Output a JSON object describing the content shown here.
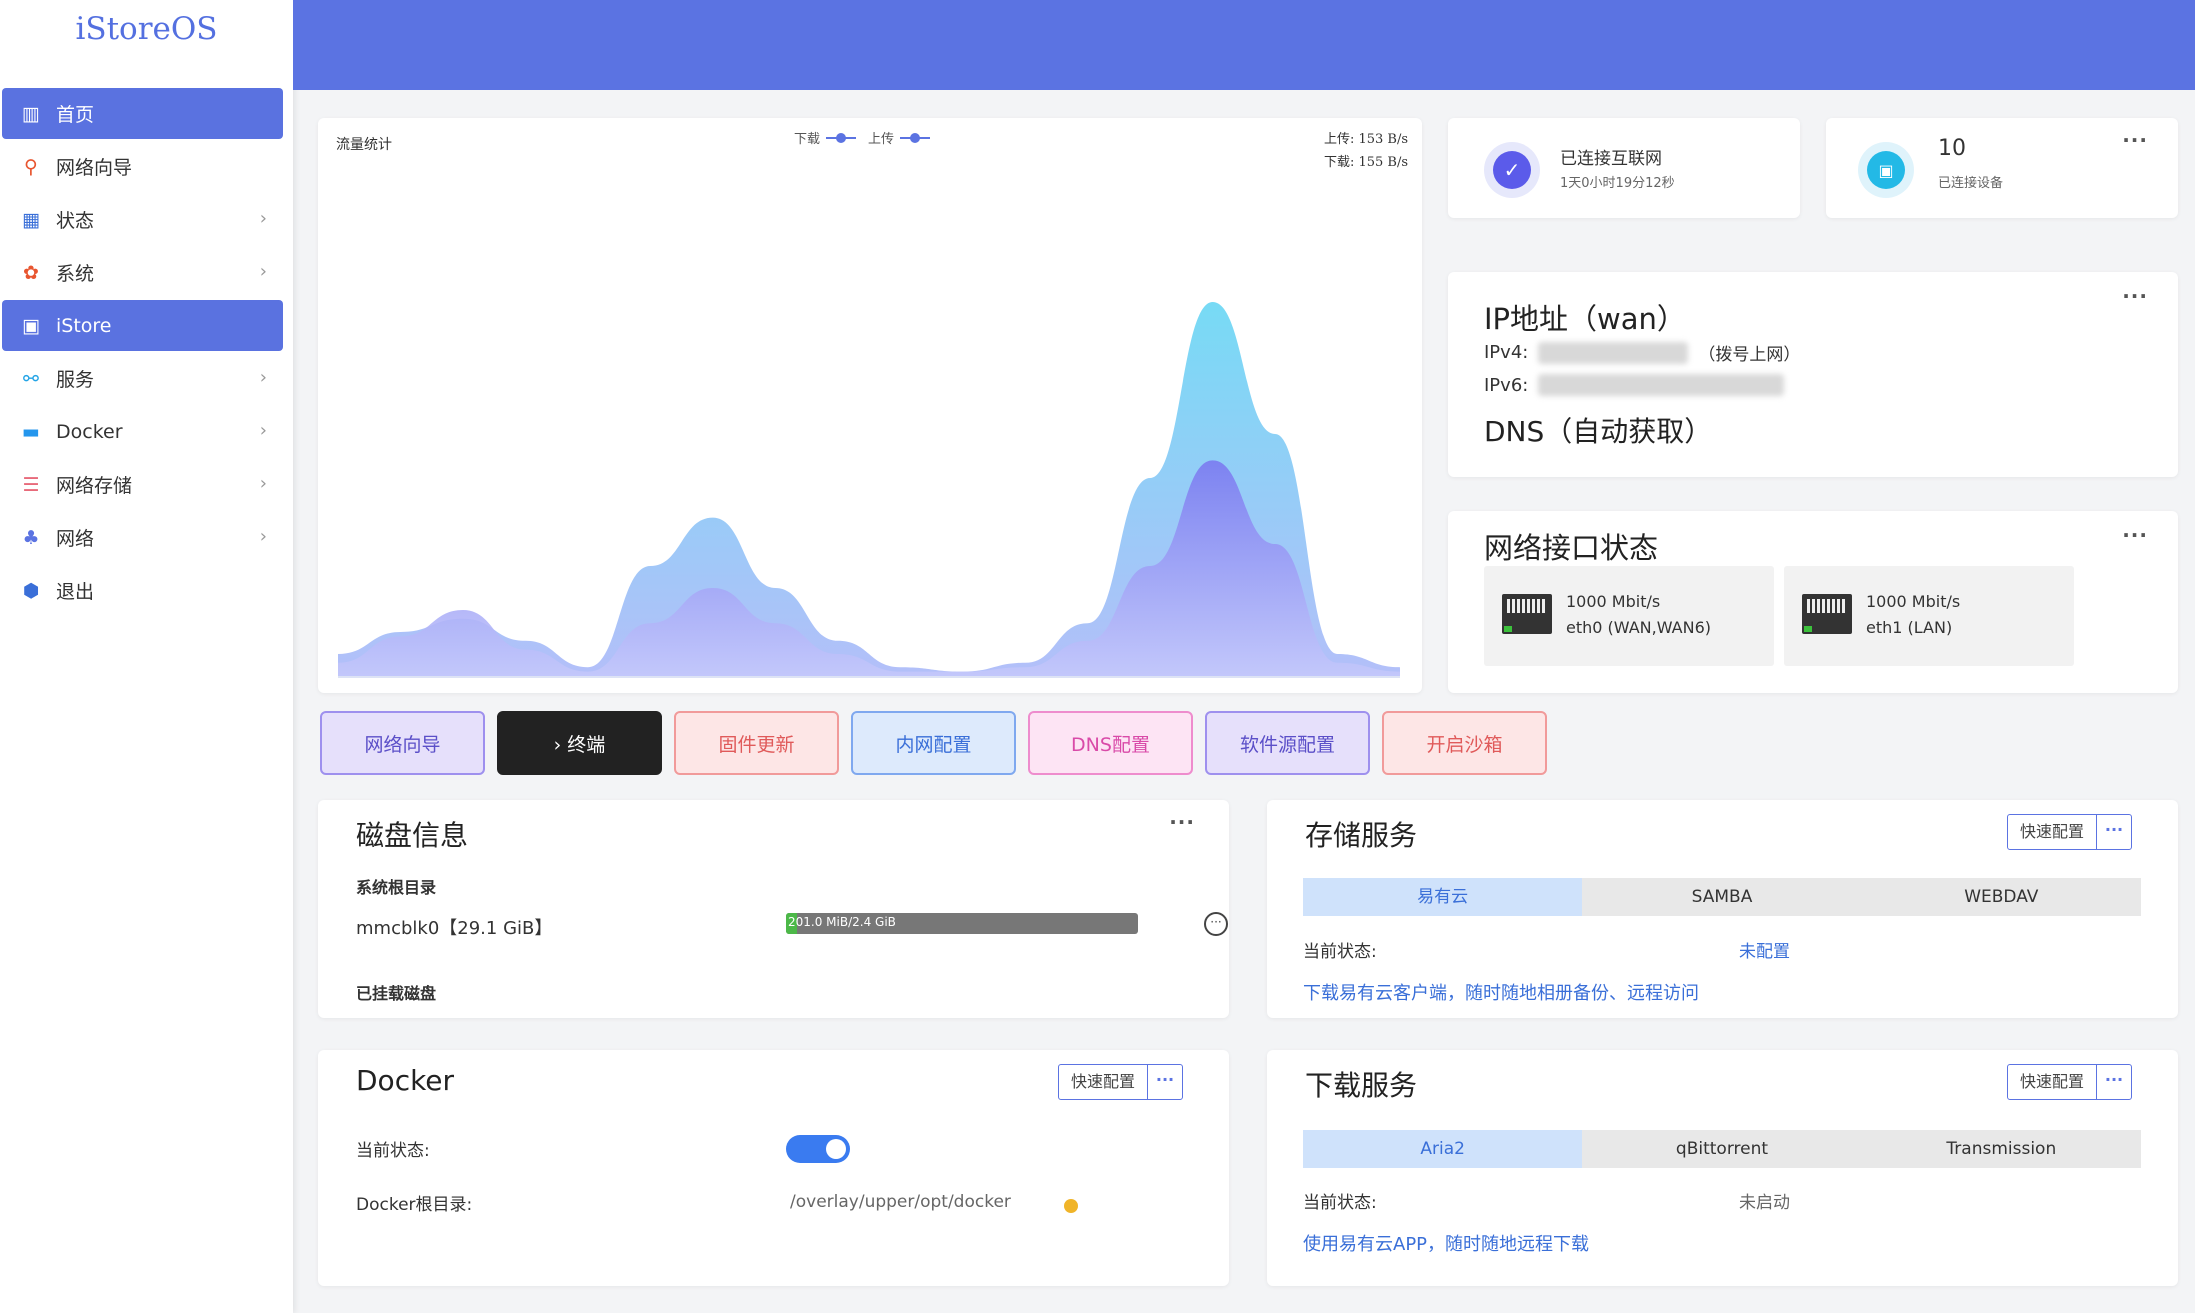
{
  "app": {
    "logo": "iStoreOS"
  },
  "sidebar": {
    "items": [
      {
        "label": "首页",
        "icon": "home-icon",
        "active": true,
        "chevron": false
      },
      {
        "label": "网络向导",
        "icon": "wizard-icon",
        "active": false,
        "chevron": false
      },
      {
        "label": "状态",
        "icon": "status-icon",
        "active": false,
        "chevron": true
      },
      {
        "label": "系统",
        "icon": "gear-icon",
        "active": false,
        "chevron": true
      },
      {
        "label": "iStore",
        "icon": "store-icon",
        "active": true,
        "chevron": false
      },
      {
        "label": "服务",
        "icon": "services-icon",
        "active": false,
        "chevron": true
      },
      {
        "label": "Docker",
        "icon": "docker-icon",
        "active": false,
        "chevron": true
      },
      {
        "label": "网络存储",
        "icon": "storage-icon",
        "active": false,
        "chevron": true
      },
      {
        "label": "网络",
        "icon": "network-icon",
        "active": false,
        "chevron": true
      },
      {
        "label": "退出",
        "icon": "logout-icon",
        "active": false,
        "chevron": false
      }
    ],
    "chevron": "›"
  },
  "traffic": {
    "title": "流量统计",
    "legend_download": "下载",
    "legend_upload": "上传",
    "upload_rate": "上传: 153 B/s",
    "download_rate": "下载: 155 B/s"
  },
  "chart_data": {
    "type": "area",
    "title": "流量统计",
    "series": [
      {
        "name": "下载",
        "values": [
          0.05,
          0.1,
          0.13,
          0.08,
          0.02,
          0.25,
          0.36,
          0.2,
          0.08,
          0.02,
          0.01,
          0.03,
          0.12,
          0.45,
          0.85,
          0.55,
          0.05,
          0.02
        ]
      },
      {
        "name": "上传",
        "values": [
          0.03,
          0.09,
          0.15,
          0.06,
          0.01,
          0.12,
          0.2,
          0.12,
          0.05,
          0.01,
          0.01,
          0.02,
          0.08,
          0.25,
          0.49,
          0.3,
          0.03,
          0.01
        ]
      }
    ],
    "colors": {
      "download_top": "#5fd4f3",
      "download_bottom": "#a6b4f8",
      "upload_top": "#7a7af0",
      "upload_bottom": "#b4b8f8"
    }
  },
  "internet": {
    "status": "已连接互联网",
    "uptime": "1天0小时19分12秒"
  },
  "devices": {
    "count": "10",
    "label": "已连接设备",
    "more": "···"
  },
  "ip": {
    "title": "IP地址（wan）",
    "ipv4_label": "IPv4:",
    "ipv4_mode": "（拨号上网）",
    "ipv6_label": "IPv6:",
    "dns": "DNS（自动获取）",
    "more": "···"
  },
  "interfaces": {
    "title": "网络接口状态",
    "more": "···",
    "items": [
      {
        "speed": "1000 Mbit/s",
        "name": "eth0 (WAN,WAN6)"
      },
      {
        "speed": "1000 Mbit/s",
        "name": "eth1 (LAN)"
      }
    ]
  },
  "quick_buttons": [
    {
      "label": "网络向导",
      "bg": "#e6e0fb",
      "border": "#9e90ee",
      "color": "#5b4fc8"
    },
    {
      "label": "› 终端",
      "bg": "#222222",
      "border": "#222222",
      "color": "#ffffff"
    },
    {
      "label": "固件更新",
      "bg": "#fde6e6",
      "border": "#f19a9a",
      "color": "#e05a5a"
    },
    {
      "label": "内网配置",
      "bg": "#ddeafc",
      "border": "#7fa8ef",
      "color": "#3a6fd8"
    },
    {
      "label": "DNS配置",
      "bg": "#fde4f4",
      "border": "#ee8ccd",
      "color": "#d94aa8"
    },
    {
      "label": "软件源配置",
      "bg": "#e6e0fb",
      "border": "#9e90ee",
      "color": "#5b4fc8"
    },
    {
      "label": "开启沙箱",
      "bg": "#fde6e6",
      "border": "#f19a9a",
      "color": "#e05a5a"
    }
  ],
  "disk": {
    "title": "磁盘信息",
    "more": "···",
    "root_label": "系统根目录",
    "device": "mmcblk0【29.1 GiB】",
    "bar_text": "201.0 MiB/2.4 GiB",
    "usage_fraction": 0.03,
    "mounted_label": "已挂载磁盘",
    "circle_more": "···"
  },
  "storage": {
    "title": "存储服务",
    "quick_config": "快速配置",
    "more": "···",
    "tabs": [
      "易有云",
      "SAMBA",
      "WEBDAV"
    ],
    "status_label": "当前状态:",
    "status_value": "未配置",
    "link": "下载易有云客户端，随时随地相册备份、远程访问"
  },
  "docker": {
    "title": "Docker",
    "quick_config": "快速配置",
    "more": "···",
    "status_label": "当前状态:",
    "root_label": "Docker根目录:",
    "root_value": "/overlay/upper/opt/docker",
    "enabled": true
  },
  "download": {
    "title": "下载服务",
    "quick_config": "快速配置",
    "more": "···",
    "tabs": [
      "Aria2",
      "qBittorrent",
      "Transmission"
    ],
    "status_label": "当前状态:",
    "status_value": "未启动",
    "link": "使用易有云APP，随时随地远程下载"
  }
}
